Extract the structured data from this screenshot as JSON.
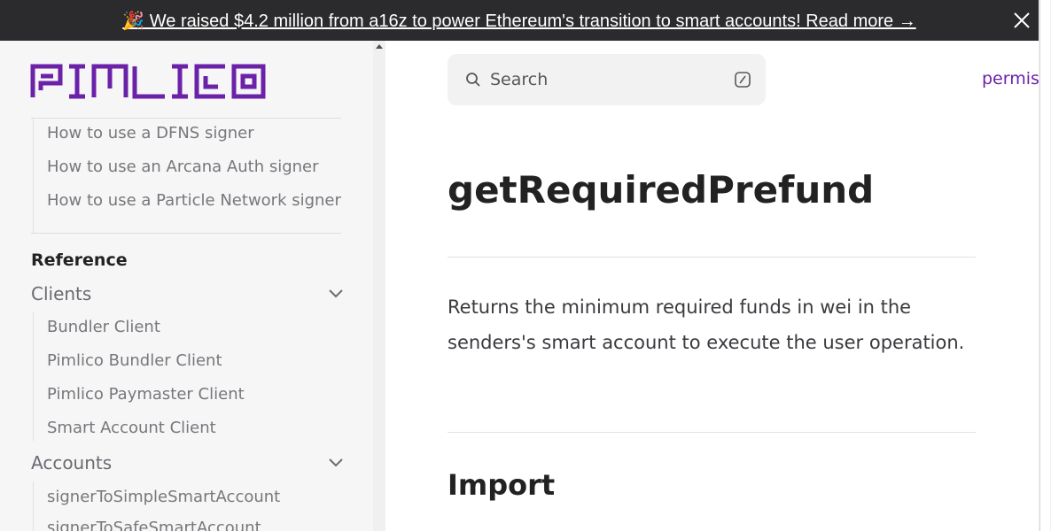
{
  "banner": {
    "text": "🎉 We raised $4.2 million from a16z to power Ethereum's transition to smart accounts! Read more →"
  },
  "logo": {
    "text": "PIMLICO",
    "color": "#6b21a8"
  },
  "sidebar": {
    "signer_items": [
      "How to use a DFNS signer",
      "How to use an Arcana Auth signer",
      "How to use a Particle Network signer"
    ],
    "reference_label": "Reference",
    "clients_label": "Clients",
    "client_items": [
      "Bundler Client",
      "Pimlico Bundler Client",
      "Pimlico Paymaster Client",
      "Smart Account Client"
    ],
    "accounts_label": "Accounts",
    "account_items": [
      "signerToSimpleSmartAccount",
      "signerToSafeSmartAccount"
    ]
  },
  "search": {
    "label": "Search"
  },
  "top_link": {
    "label": "permis"
  },
  "main": {
    "title": "getRequiredPrefund",
    "description": "Returns the minimum required funds in wei in the senders's smart account to execute the user operation.",
    "section_heading": "Import"
  },
  "colors": {
    "accent": "#6b21a8",
    "banner_bg": "#2b2b2d",
    "sidebar_bg": "#f6f6f7"
  }
}
